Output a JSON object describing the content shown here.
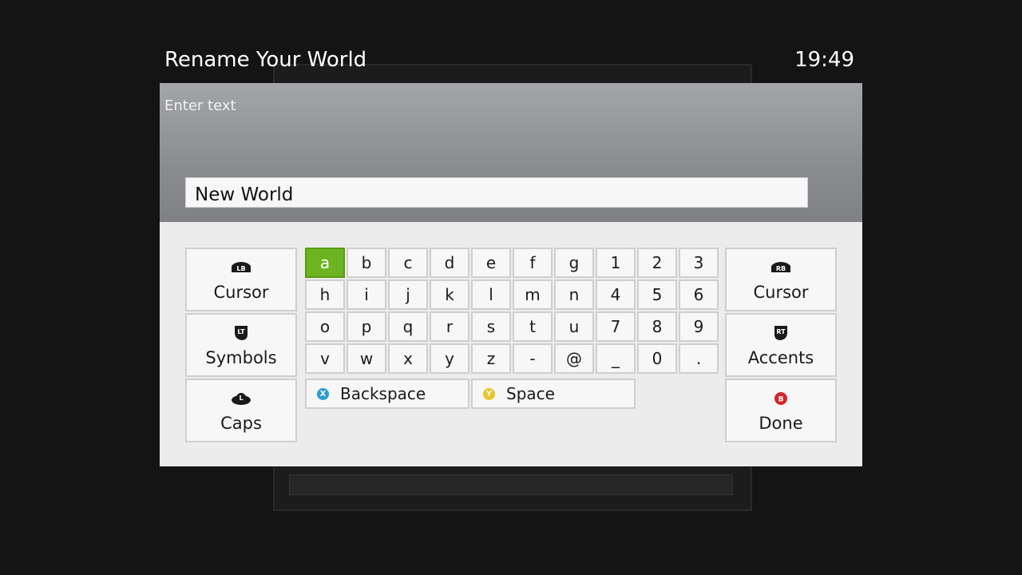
{
  "header": {
    "title": "Rename Your World",
    "clock": "19:49"
  },
  "dialog": {
    "prompt": "Enter text",
    "input_value": "New World"
  },
  "keyboard": {
    "selected_key": "a",
    "rows": [
      [
        "a",
        "b",
        "c",
        "d",
        "e",
        "f",
        "g",
        "1",
        "2",
        "3"
      ],
      [
        "h",
        "i",
        "j",
        "k",
        "l",
        "m",
        "n",
        "4",
        "5",
        "6"
      ],
      [
        "o",
        "p",
        "q",
        "r",
        "s",
        "t",
        "u",
        "7",
        "8",
        "9"
      ],
      [
        "v",
        "w",
        "x",
        "y",
        "z",
        "-",
        "@",
        "_",
        "0",
        "."
      ]
    ],
    "backspace": {
      "label": "Backspace",
      "button": "X",
      "color": "#2d9ad6"
    },
    "space": {
      "label": "Space",
      "button": "Y",
      "color": "#e8c52a"
    }
  },
  "left_keys": [
    {
      "label": "Cursor",
      "glyph": "LB",
      "icon": "lb-bumper-icon"
    },
    {
      "label": "Symbols",
      "glyph": "LT",
      "icon": "lt-trigger-icon"
    },
    {
      "label": "Caps",
      "glyph": "L",
      "icon": "left-stick-icon"
    }
  ],
  "right_keys": [
    {
      "label": "Cursor",
      "glyph": "RB",
      "icon": "rb-bumper-icon"
    },
    {
      "label": "Accents",
      "glyph": "RT",
      "icon": "rt-trigger-icon"
    },
    {
      "label": "Done",
      "glyph": "B",
      "icon": "b-button-icon",
      "color": "#d4272e"
    }
  ],
  "colors": {
    "accent": "#6cb520",
    "key_bg": "#f7f7f7",
    "panel_bg": "#ececec"
  }
}
